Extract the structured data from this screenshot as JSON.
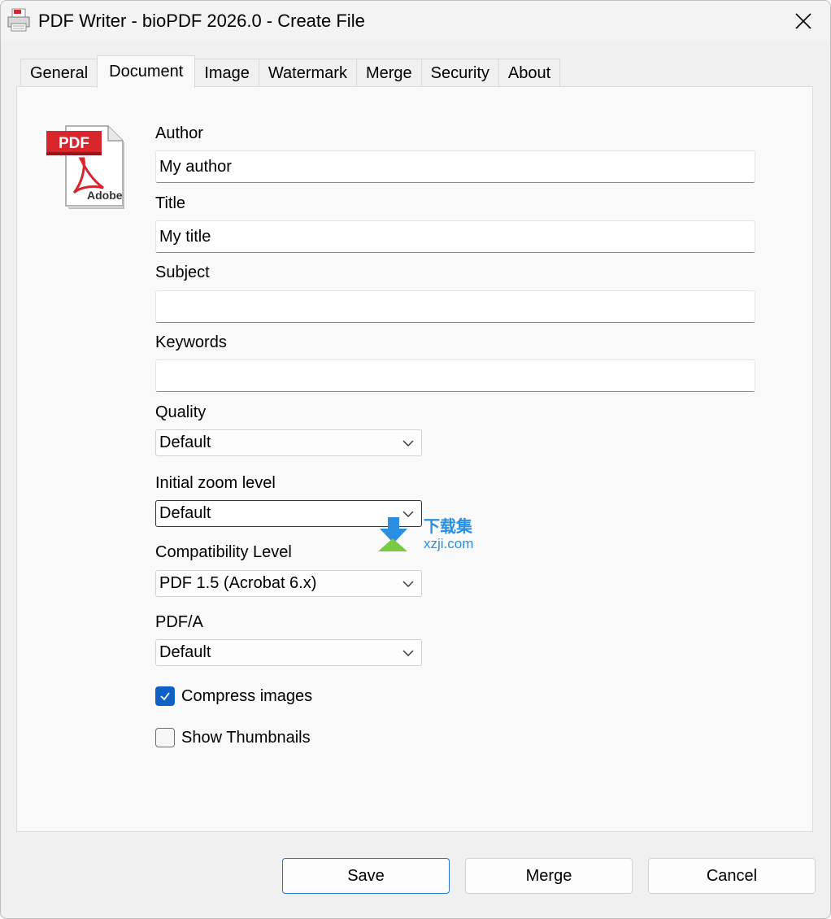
{
  "window": {
    "title": "PDF Writer - bioPDF 2026.0 - Create File"
  },
  "tabs": [
    {
      "label": "General",
      "active": false
    },
    {
      "label": "Document",
      "active": true
    },
    {
      "label": "Image",
      "active": false
    },
    {
      "label": "Watermark",
      "active": false
    },
    {
      "label": "Merge",
      "active": false
    },
    {
      "label": "Security",
      "active": false
    },
    {
      "label": "About",
      "active": false
    }
  ],
  "icon": {
    "badge": "PDF",
    "brand": "Adobe"
  },
  "fields": {
    "author": {
      "label": "Author",
      "value": "My author"
    },
    "title": {
      "label": "Title",
      "value": "My title"
    },
    "subject": {
      "label": "Subject",
      "value": ""
    },
    "keywords": {
      "label": "Keywords",
      "value": ""
    }
  },
  "selects": {
    "quality": {
      "label": "Quality",
      "value": "Default"
    },
    "zoom": {
      "label": "Initial zoom level",
      "value": "Default"
    },
    "compat": {
      "label": "Compatibility Level",
      "value": "PDF 1.5 (Acrobat 6.x)"
    },
    "pdfa": {
      "label": "PDF/A",
      "value": "Default"
    }
  },
  "checkboxes": {
    "compress": {
      "label": "Compress images",
      "checked": true
    },
    "thumbs": {
      "label": "Show Thumbnails",
      "checked": false
    }
  },
  "buttons": {
    "save": "Save",
    "merge": "Merge",
    "cancel": "Cancel"
  },
  "watermark": {
    "cn": "下载集",
    "site": "xzji.com"
  },
  "colors": {
    "accent": "#0f62c4",
    "pdf_red": "#d8262c"
  }
}
